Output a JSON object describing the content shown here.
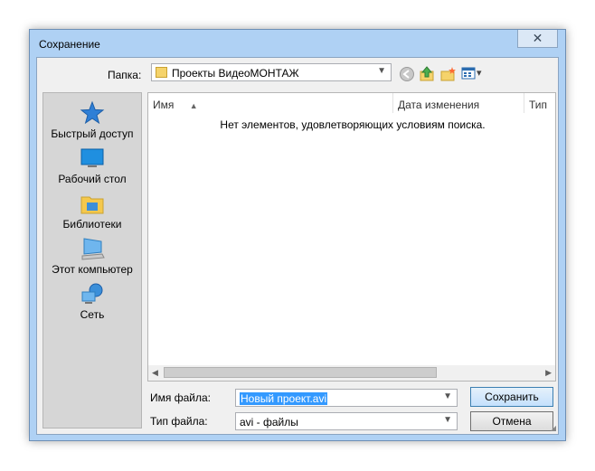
{
  "window": {
    "title": "Сохранение",
    "close_symbol": "✕"
  },
  "toolbar": {
    "folder_label": "Папка:",
    "folder_value": "Проекты ВидеоМОНТАЖ",
    "dropdown_arrow": "▼",
    "views_arrow": "▾"
  },
  "places": {
    "items": [
      {
        "label": "Быстрый доступ",
        "icon": "star-icon"
      },
      {
        "label": "Рабочий стол",
        "icon": "desktop-icon"
      },
      {
        "label": "Библиотеки",
        "icon": "libraries-icon"
      },
      {
        "label": "Этот компьютер",
        "icon": "computer-icon"
      },
      {
        "label": "Сеть",
        "icon": "network-icon"
      }
    ]
  },
  "filelist": {
    "columns": [
      "Имя",
      "Дата изменения",
      "Тип"
    ],
    "sort_arrow": "▲",
    "empty_message": "Нет элементов, удовлетворяющих условиям поиска.",
    "scroll_left": "◀",
    "scroll_right": "▶"
  },
  "form": {
    "filename_label": "Имя файла:",
    "filename_value": "Новый проект.avi",
    "filetype_label": "Тип файла:",
    "filetype_value": "avi - файлы",
    "save_button": "Сохранить",
    "cancel_button": "Отмена"
  },
  "colors": {
    "accent": "#3399ff",
    "frame": "#afd1f4"
  }
}
